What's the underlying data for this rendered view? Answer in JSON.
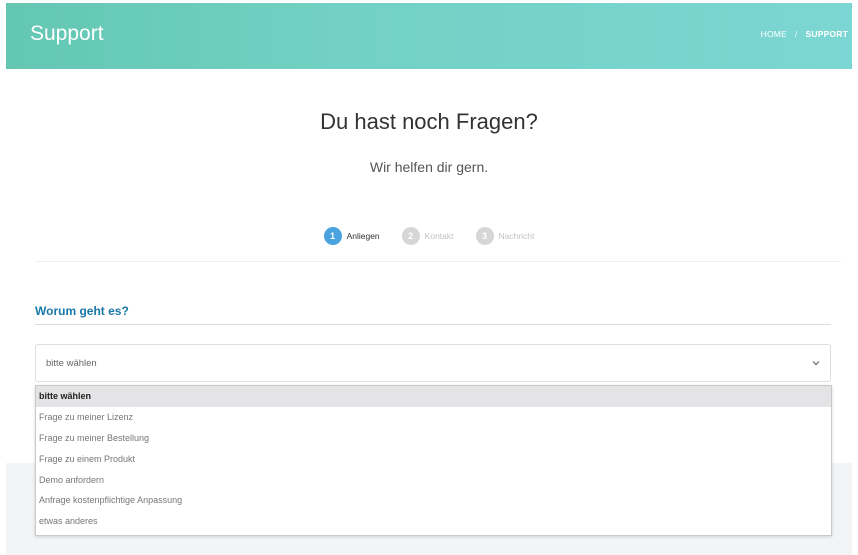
{
  "header": {
    "title": "Support",
    "breadcrumb": {
      "home": "HOME",
      "separator": "/",
      "current": "SUPPORT"
    },
    "gradient_colors": [
      "#63c7b2",
      "#7cd6d3"
    ]
  },
  "hero": {
    "headline": "Du hast noch Fragen?",
    "subline": "Wir helfen dir gern."
  },
  "steps": [
    {
      "number": "1",
      "label": "Anliegen",
      "state": "active"
    },
    {
      "number": "2",
      "label": "Kontakt",
      "state": "inactive"
    },
    {
      "number": "3",
      "label": "Nachricht",
      "state": "inactive"
    }
  ],
  "form": {
    "section_title": "Worum geht es?",
    "select": {
      "value": "bitte wählen",
      "icon": "chevron-down-icon",
      "options": [
        "bitte wählen",
        "Frage zu meiner Lizenz",
        "Frage zu meiner Bestellung",
        "Frage zu einem Produkt",
        "Demo anfordern",
        "Anfrage kostenpflichtige Anpassung",
        "etwas anderes"
      ],
      "highlighted_index": 0
    }
  },
  "colors": {
    "accent": "#4aa3df",
    "section_title": "#1a78a8"
  }
}
